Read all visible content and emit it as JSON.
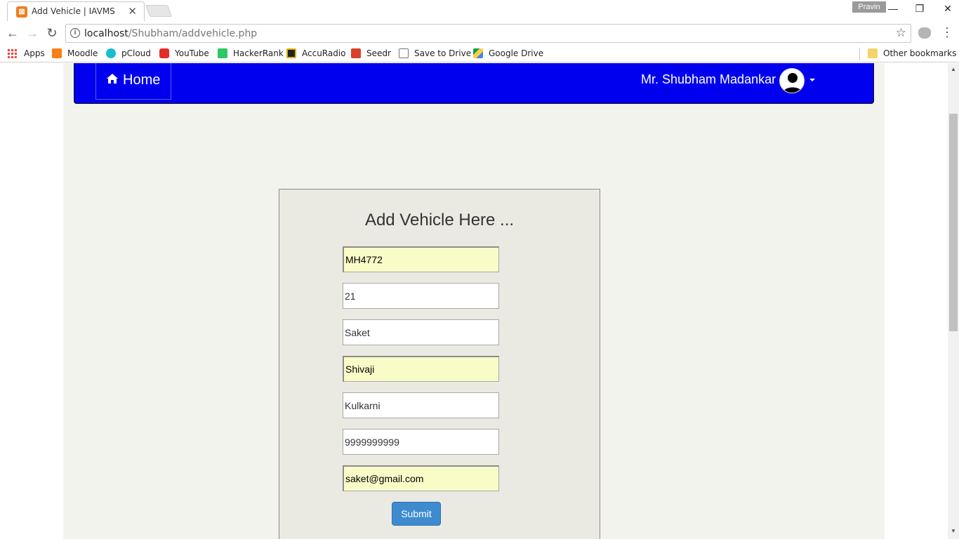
{
  "browser": {
    "tab_title": "Add Vehicle | IAVMS",
    "profile_name": "Pravin",
    "url_host": "localhost",
    "url_path": "/Shubham/addvehicle.php",
    "bookmarks": [
      "Apps",
      "Moodle",
      "pCloud",
      "YouTube",
      "HackerRank",
      "AccuRadio",
      "Seedr",
      "Save to Drive",
      "Google Drive"
    ],
    "other_bookmarks": "Other bookmarks"
  },
  "navbar": {
    "home_label": "Home",
    "user_name": "Mr. Shubham Madankar"
  },
  "form": {
    "title": "Add Vehicle Here ...",
    "fields": [
      "MH4772",
      "21",
      "Saket",
      "Shivaji",
      "Kulkarni",
      "9999999999",
      "saket@gmail.com"
    ],
    "submit_label": "Submit"
  },
  "colors": {
    "navbar_bg": "#0000ee",
    "autofill_bg": "#fafcc8",
    "submit_bg": "#3f8bd0"
  }
}
